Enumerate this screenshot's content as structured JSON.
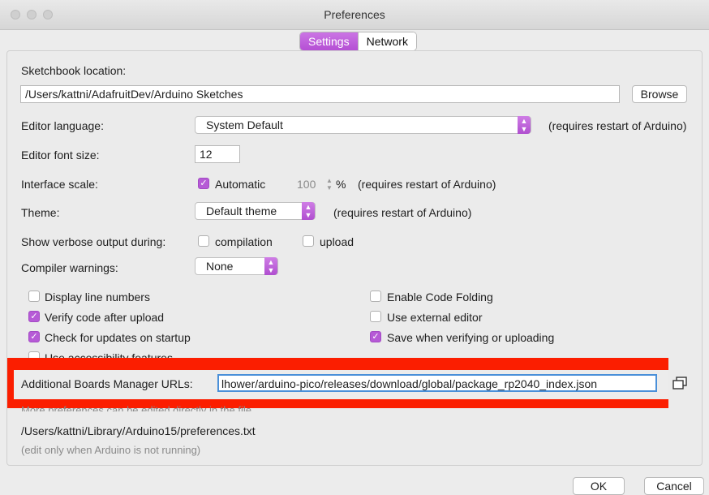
{
  "window": {
    "title": "Preferences"
  },
  "tabs": [
    {
      "label": "Settings",
      "active": true
    },
    {
      "label": "Network",
      "active": false
    }
  ],
  "sketchbook": {
    "label": "Sketchbook location:",
    "value": "/Users/kattni/AdafruitDev/Arduino Sketches",
    "browse_label": "Browse"
  },
  "editor_language": {
    "label": "Editor language:",
    "value": "System Default",
    "note": "(requires restart of Arduino)"
  },
  "editor_font_size": {
    "label": "Editor font size:",
    "value": "12"
  },
  "interface_scale": {
    "label": "Interface scale:",
    "automatic_label": "Automatic",
    "automatic_checked": true,
    "value": "100",
    "unit": "%",
    "note": "(requires restart of Arduino)"
  },
  "theme": {
    "label": "Theme:",
    "value": "Default theme",
    "note": "(requires restart of Arduino)"
  },
  "verbose": {
    "label": "Show verbose output during:",
    "compilation_label": "compilation",
    "upload_label": "upload"
  },
  "compiler_warnings": {
    "label": "Compiler warnings:",
    "value": "None"
  },
  "options_left": [
    {
      "label": "Display line numbers",
      "checked": false
    },
    {
      "label": "Verify code after upload",
      "checked": true
    },
    {
      "label": "Check for updates on startup",
      "checked": true
    },
    {
      "label": "Use accessibility features",
      "checked": false
    }
  ],
  "options_right": [
    {
      "label": "Enable Code Folding",
      "checked": false
    },
    {
      "label": "Use external editor",
      "checked": false
    },
    {
      "label": "Save when verifying or uploading",
      "checked": true
    }
  ],
  "boards_manager": {
    "label": "Additional Boards Manager URLs:",
    "value": "lhower/arduino-pico/releases/download/global/package_rp2040_index.json"
  },
  "footer": {
    "more_text": "More preferences can be edited directly in the file",
    "path": "/Users/kattni/Library/Arduino15/preferences.txt",
    "hint": "(edit only when Arduino is not running)"
  },
  "buttons": {
    "ok": "OK",
    "cancel": "Cancel"
  },
  "colors": {
    "accent": "#b65ad6",
    "highlight": "#fb1e00",
    "background": "#ececec"
  }
}
